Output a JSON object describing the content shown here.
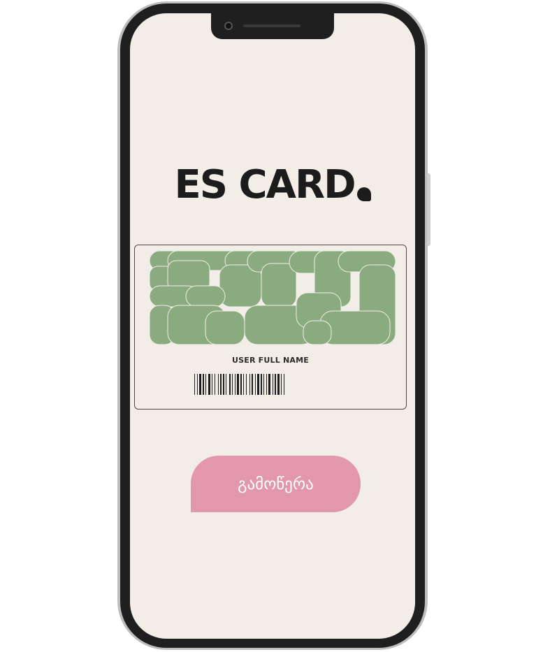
{
  "app": {
    "logo_text": "ES CARD"
  },
  "card": {
    "user_name": "USER FULL NAME",
    "pattern_color": "#8aab7f",
    "barcode_color": "#1c1c1c"
  },
  "actions": {
    "subscribe_label": "გამოწერა"
  },
  "colors": {
    "screen_background": "#f3ede7",
    "button_pink": "#e297ad",
    "frame": "#1f1f1f"
  },
  "icons": [
    "camera-icon",
    "logo-dot-icon",
    "barcode-icon"
  ]
}
